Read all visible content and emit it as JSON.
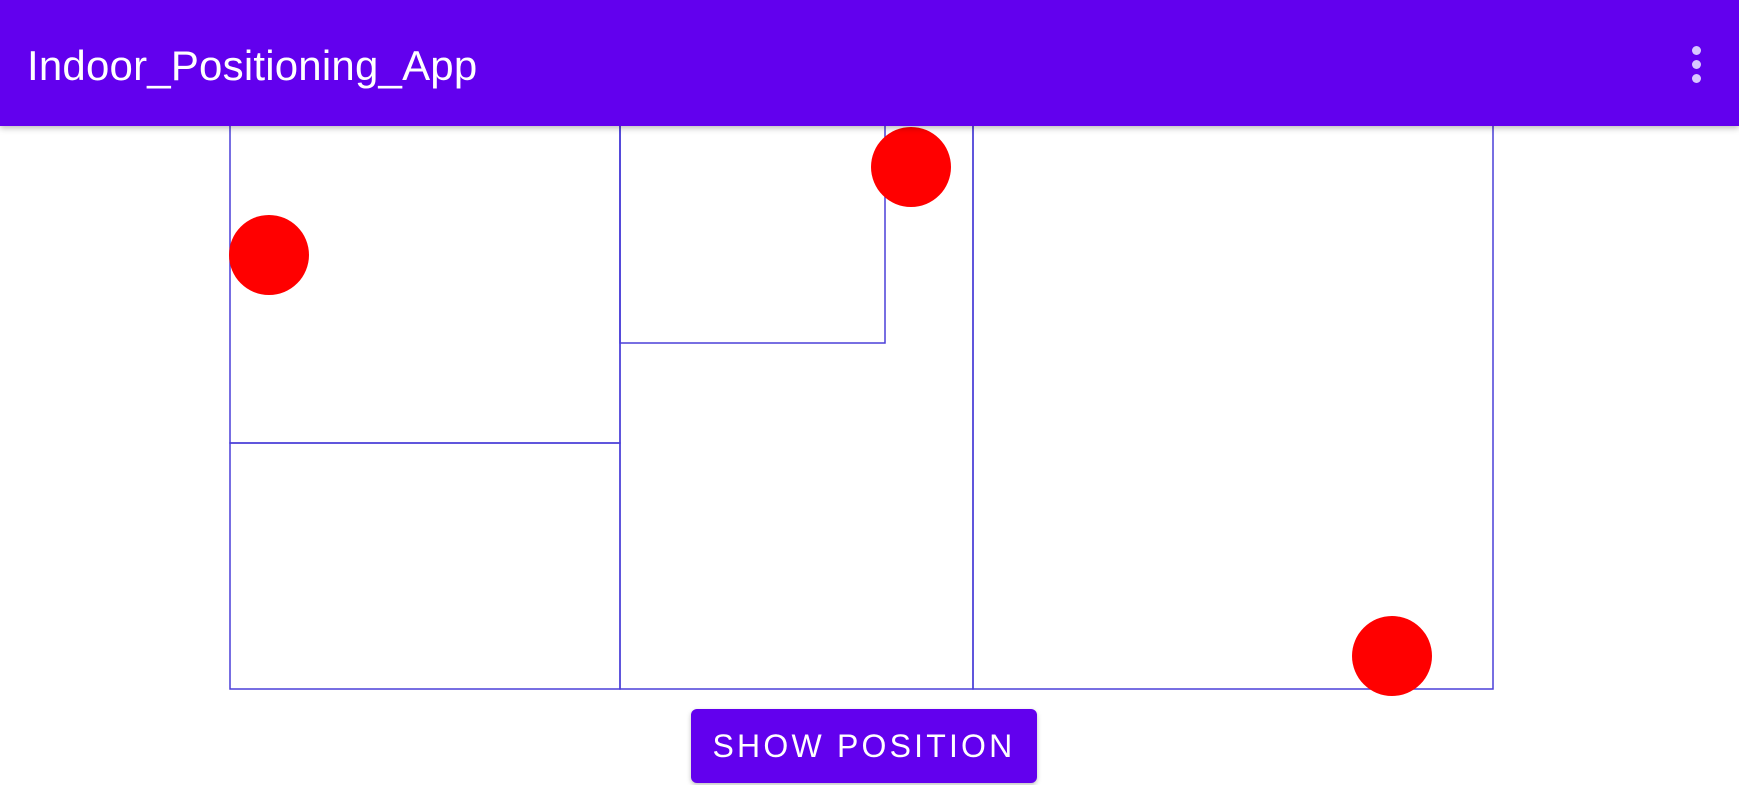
{
  "app": {
    "title": "Indoor_Positioning_App",
    "overflow_icon": "more-vert-icon"
  },
  "floor_plan": {
    "rooms": [
      "room-top-left",
      "room-bottom-left",
      "room-small-center",
      "room-center",
      "room-right"
    ],
    "markers": [
      "position-marker",
      "position-marker",
      "position-marker"
    ],
    "wall_color": "#4a3fd8",
    "marker_color": "#ff0000"
  },
  "actions": {
    "show_position_label": "SHOW POSITION"
  },
  "colors": {
    "primary": "#6200ee",
    "on_primary": "#ffffff"
  }
}
